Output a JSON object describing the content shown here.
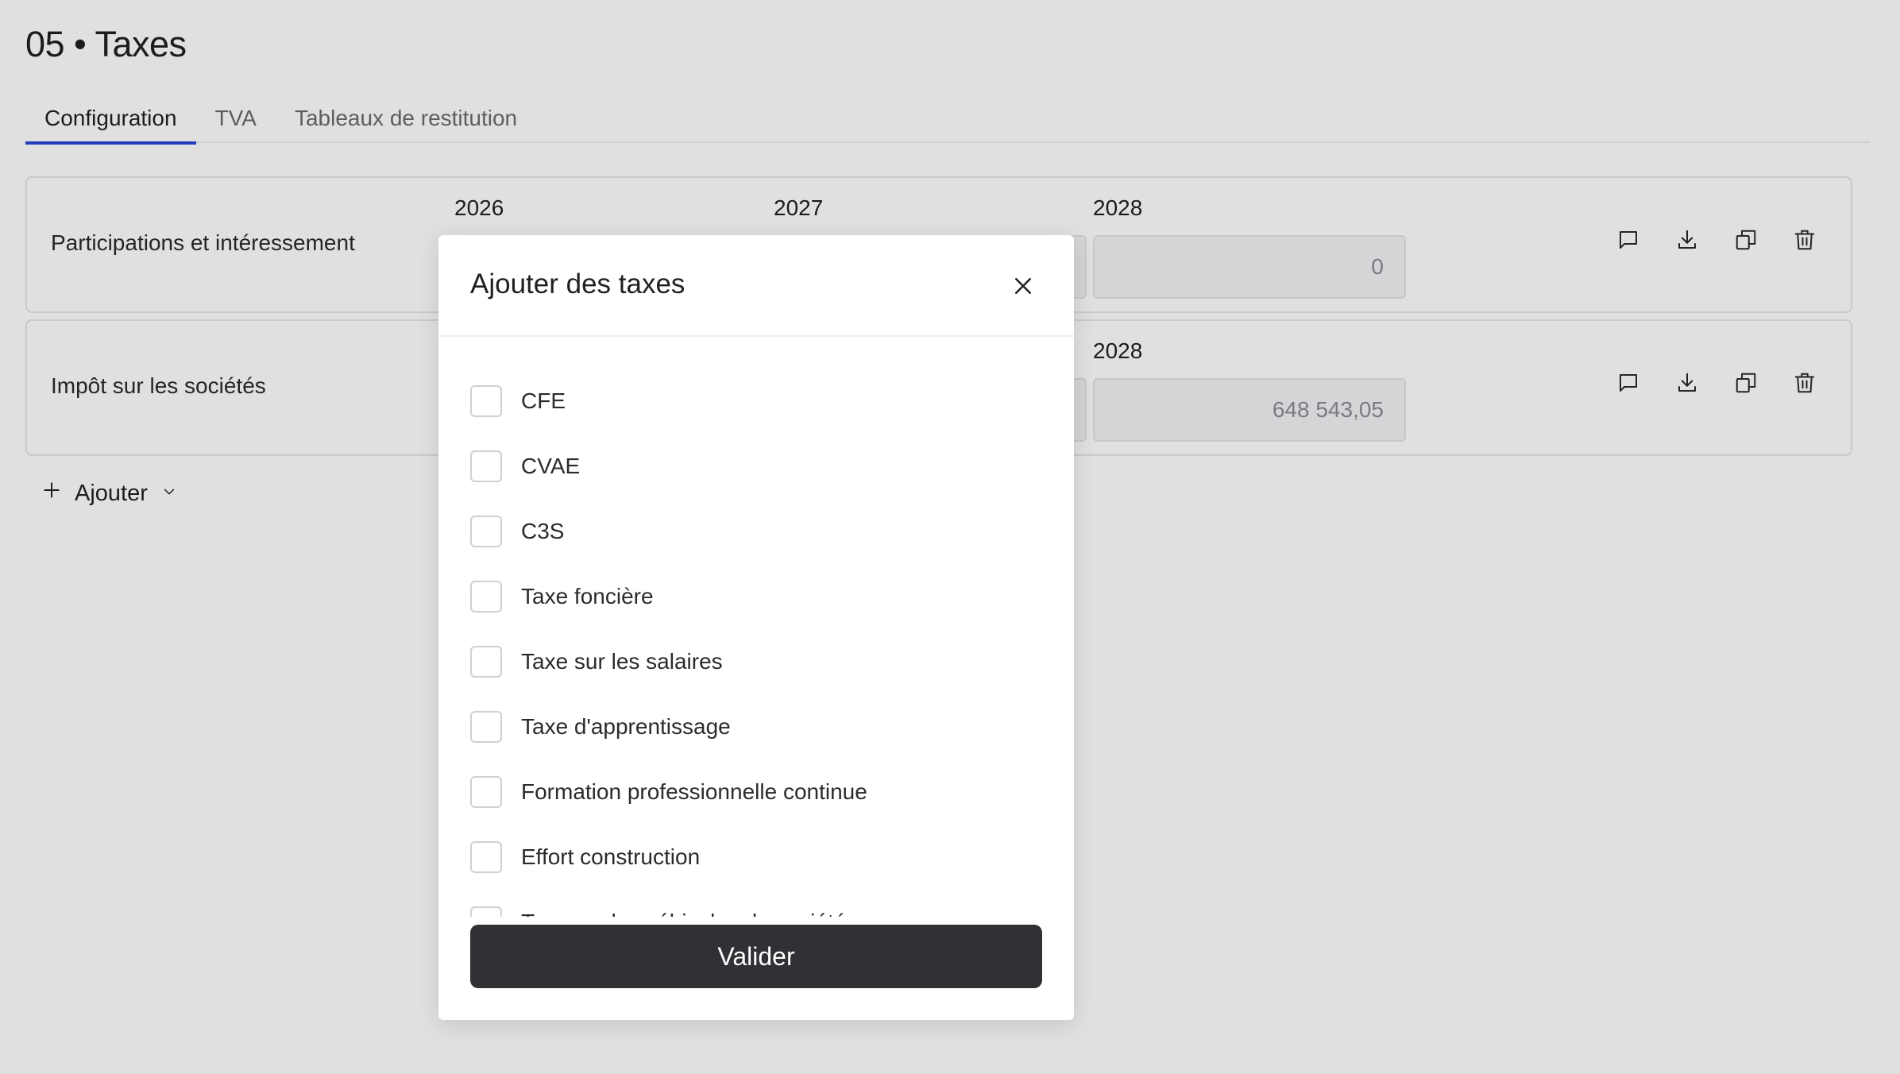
{
  "page": {
    "title": "05 • Taxes"
  },
  "tabs": [
    {
      "label": "Configuration",
      "active": true
    },
    {
      "label": "TVA",
      "active": false
    },
    {
      "label": "Tableaux de restitution",
      "active": false
    }
  ],
  "rows": [
    {
      "label": "Participations et intéressement",
      "years": [
        {
          "year": "2026",
          "value": ""
        },
        {
          "year": "2027",
          "value": ""
        },
        {
          "year": "2028",
          "value": "0"
        }
      ]
    },
    {
      "label": "Impôt sur les sociétés",
      "years": [
        {
          "year": "",
          "value": ""
        },
        {
          "year": "",
          "value": ""
        },
        {
          "year": "2028",
          "value": "648 543,05"
        }
      ]
    }
  ],
  "actions": {
    "icons": [
      "comment-icon",
      "download-icon",
      "duplicate-icon",
      "trash-icon"
    ]
  },
  "add_button": {
    "label": "Ajouter"
  },
  "modal": {
    "title": "Ajouter des taxes",
    "options": [
      "CFE",
      "CVAE",
      "C3S",
      "Taxe foncière",
      "Taxe sur les salaires",
      "Taxe d'apprentissage",
      "Formation professionnelle continue",
      "Effort construction",
      "Taxe sur les véhicules de société"
    ],
    "submit_label": "Valider"
  },
  "colors": {
    "tab_accent": "#2b46d8",
    "submit_bg": "#303134",
    "overlay": "rgba(0,0,0,0.12)"
  }
}
